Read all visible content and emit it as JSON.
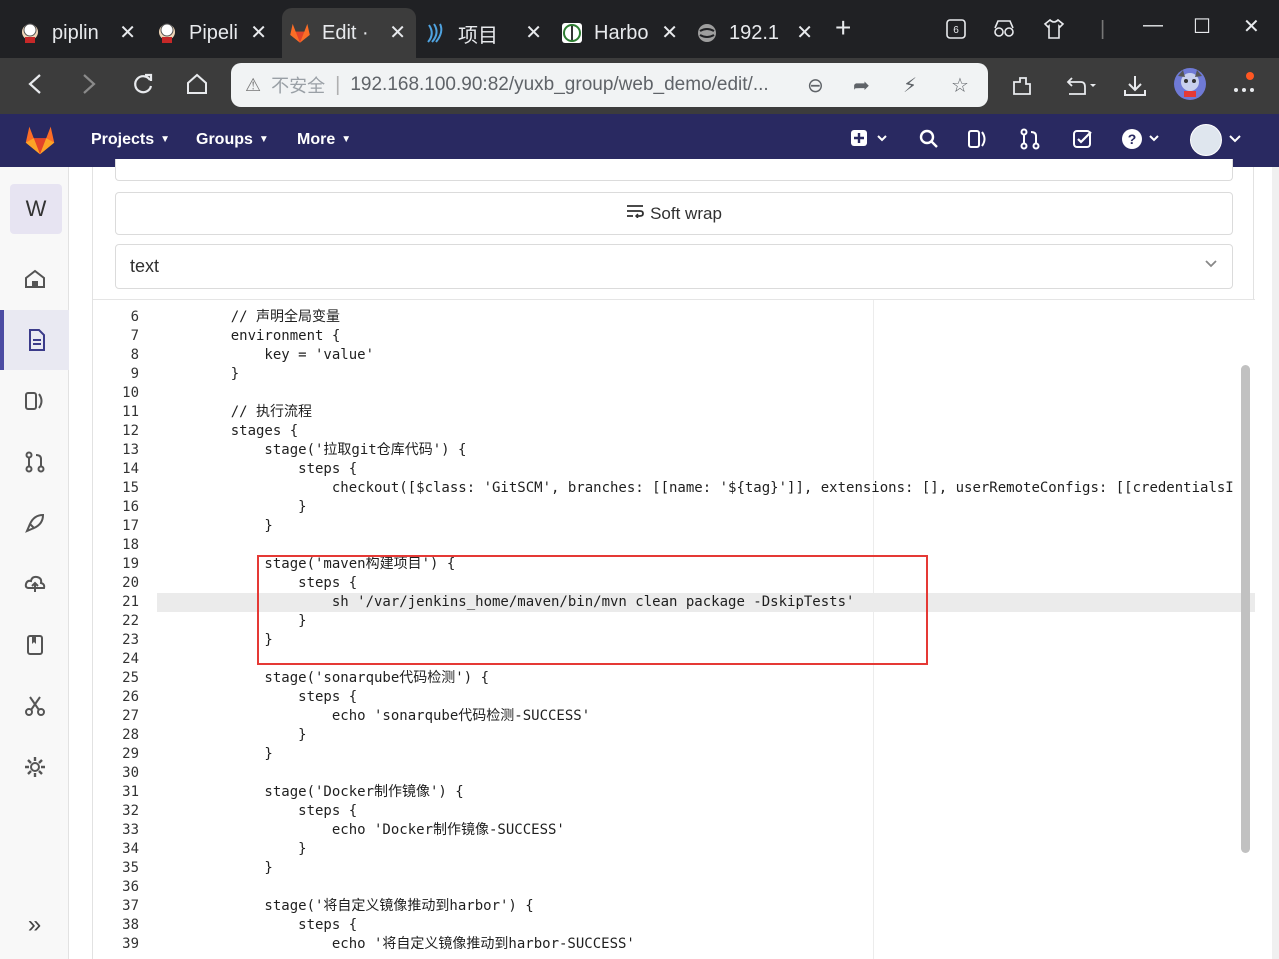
{
  "browser": {
    "tabs": [
      {
        "title": "piplin",
        "favicon": "jenkins-icon"
      },
      {
        "title": "Pipeli",
        "favicon": "jenkins-icon"
      },
      {
        "title": "Edit ·",
        "favicon": "gitlab-icon",
        "active": true
      },
      {
        "title": "项目",
        "favicon": "sonar-icon"
      },
      {
        "title": "Harbo",
        "favicon": "harbor-icon"
      },
      {
        "title": "192.1",
        "favicon": "globe-icon"
      }
    ],
    "tab_count_badge": "6",
    "address": {
      "security_label": "不安全",
      "url": "192.168.100.90:82/yuxb_group/web_demo/edit/..."
    }
  },
  "gitlab": {
    "nav": {
      "projects": "Projects",
      "groups": "Groups",
      "more": "More"
    },
    "sidebar": {
      "workspace_initial": "W",
      "items": [
        "home-icon",
        "file-icon",
        "issues-icon",
        "merge-request-icon",
        "deploy-icon",
        "monitor-icon",
        "wiki-icon",
        "snippets-icon",
        "settings-icon"
      ],
      "collapse": "»"
    },
    "editor": {
      "soft_wrap_label": "Soft wrap",
      "language": "text",
      "current_line": 21,
      "lines": [
        {
          "n": "6",
          "code": "    // 声明全局变量"
        },
        {
          "n": "7",
          "code": "    environment {"
        },
        {
          "n": "8",
          "code": "        key = 'value'"
        },
        {
          "n": "9",
          "code": "    }"
        },
        {
          "n": "10",
          "code": ""
        },
        {
          "n": "11",
          "code": "    // 执行流程"
        },
        {
          "n": "12",
          "code": "    stages {"
        },
        {
          "n": "13",
          "code": "        stage('拉取git仓库代码') {"
        },
        {
          "n": "14",
          "code": "            steps {"
        },
        {
          "n": "15",
          "code": "                checkout([$class: 'GitSCM', branches: [[name: '${tag}']], extensions: [], userRemoteConfigs: [[credentialsI"
        },
        {
          "n": "16",
          "code": "            }"
        },
        {
          "n": "17",
          "code": "        }"
        },
        {
          "n": "18",
          "code": ""
        },
        {
          "n": "19",
          "code": "        stage('maven构建项目') {"
        },
        {
          "n": "20",
          "code": "            steps {"
        },
        {
          "n": "21",
          "code": "                sh '/var/jenkins_home/maven/bin/mvn clean package -DskipTests'"
        },
        {
          "n": "22",
          "code": "            }"
        },
        {
          "n": "23",
          "code": "        }"
        },
        {
          "n": "24",
          "code": ""
        },
        {
          "n": "25",
          "code": "        stage('sonarqube代码检测') {"
        },
        {
          "n": "26",
          "code": "            steps {"
        },
        {
          "n": "27",
          "code": "                echo 'sonarqube代码检测-SUCCESS'"
        },
        {
          "n": "28",
          "code": "            }"
        },
        {
          "n": "29",
          "code": "        }"
        },
        {
          "n": "30",
          "code": ""
        },
        {
          "n": "31",
          "code": "        stage('Docker制作镜像') {"
        },
        {
          "n": "32",
          "code": "            steps {"
        },
        {
          "n": "33",
          "code": "                echo 'Docker制作镜像-SUCCESS'"
        },
        {
          "n": "34",
          "code": "            }"
        },
        {
          "n": "35",
          "code": "        }"
        },
        {
          "n": "36",
          "code": ""
        },
        {
          "n": "37",
          "code": "        stage('将自定义镜像推动到harbor') {"
        },
        {
          "n": "38",
          "code": "            steps {"
        },
        {
          "n": "39",
          "code": "                echo '将自定义镜像推动到harbor-SUCCESS'"
        }
      ]
    }
  },
  "colors": {
    "gitlab_header": "#292961",
    "highlight_box": "#e53935",
    "tab_bar": "#202124"
  }
}
